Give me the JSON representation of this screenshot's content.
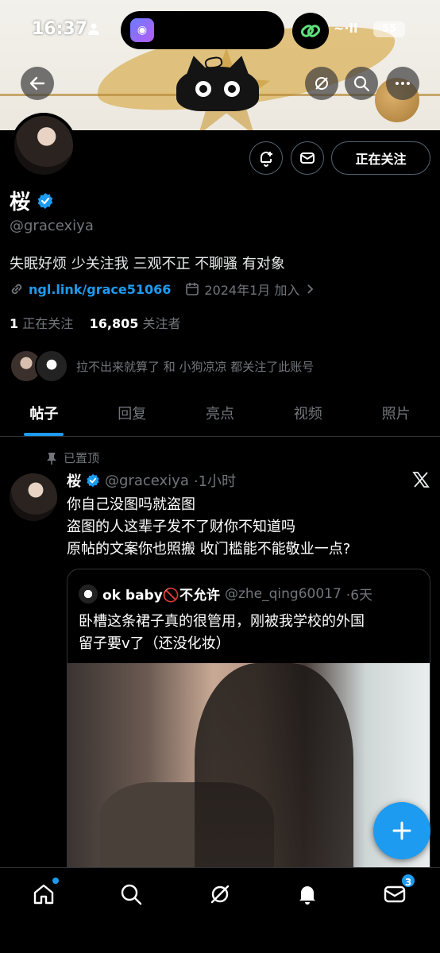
{
  "status_bar": {
    "time": "16:37",
    "signal": "~∙ll",
    "battery": "55"
  },
  "profile": {
    "display_name": "桜",
    "handle": "@gracexiya",
    "bio": "失眠好烦 少关注我 三观不正 不聊骚 有对象",
    "link": "ngl.link/grace51066",
    "joined": "2024年1月 加入",
    "following_count": "1",
    "following_label": "正在关注",
    "followers_count": "16,805",
    "followers_label": "关注者",
    "followed_by_text": "拉不出来就算了 和 小狗凉凉 都关注了此账号",
    "follow_button_label": "正在关注"
  },
  "tabs": [
    {
      "label": "帖子",
      "active": true
    },
    {
      "label": "回复",
      "active": false
    },
    {
      "label": "亮点",
      "active": false
    },
    {
      "label": "视频",
      "active": false
    },
    {
      "label": "照片",
      "active": false
    }
  ],
  "post": {
    "pinned_label": "已置顶",
    "author_name": "桜",
    "author_handle": "@gracexiya",
    "time": "·1小时",
    "lines": [
      "你自己没图吗就盗图",
      "盗图的人这辈子发不了财你不知道吗",
      "原帖的文案你也照搬 收门槛能不能敬业一点?"
    ],
    "quote": {
      "author_name": "ok baby🚫不允许",
      "author_handle": "@zhe_qing60017",
      "time": "·6天",
      "lines": [
        "卧槽这条裙子真的很管用，刚被我学校的外国",
        "留子要v了（还没化妆）"
      ]
    }
  },
  "bottom_nav": {
    "messages_badge": "3"
  },
  "colors": {
    "accent": "#1d9bf0",
    "background": "#000000",
    "secondary_text": "#71767b"
  }
}
